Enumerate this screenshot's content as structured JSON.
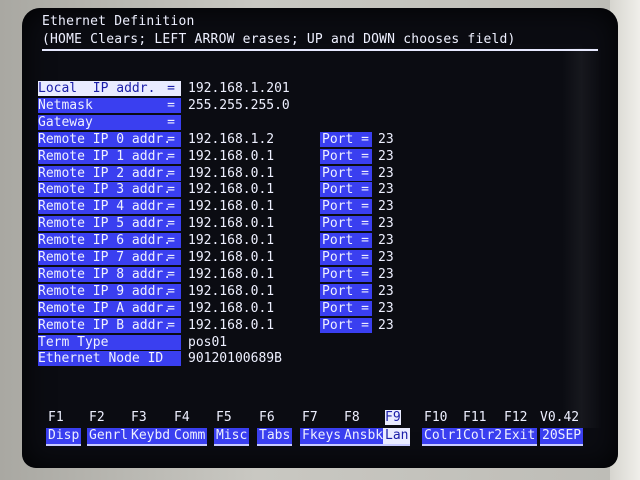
{
  "header": {
    "title": "Ethernet Definition",
    "subtitle": "(HOME Clears; LEFT ARROW erases; UP and DOWN chooses field)"
  },
  "fields": [
    {
      "label": "Local  IP addr.",
      "value": "192.168.1.201"
    },
    {
      "label": "Netmask",
      "value": "255.255.255.0"
    },
    {
      "label": "Gateway",
      "value": ""
    },
    {
      "label": "Remote IP 0 addr.",
      "value": "192.168.1.2",
      "port": "23"
    },
    {
      "label": "Remote IP 1 addr.",
      "value": "192.168.0.1",
      "port": "23"
    },
    {
      "label": "Remote IP 2 addr.",
      "value": "192.168.0.1",
      "port": "23"
    },
    {
      "label": "Remote IP 3 addr.",
      "value": "192.168.0.1",
      "port": "23"
    },
    {
      "label": "Remote IP 4 addr.",
      "value": "192.168.0.1",
      "port": "23"
    },
    {
      "label": "Remote IP 5 addr.",
      "value": "192.168.0.1",
      "port": "23"
    },
    {
      "label": "Remote IP 6 addr.",
      "value": "192.168.0.1",
      "port": "23"
    },
    {
      "label": "Remote IP 7 addr.",
      "value": "192.168.0.1",
      "port": "23"
    },
    {
      "label": "Remote IP 8 addr.",
      "value": "192.168.0.1",
      "port": "23"
    },
    {
      "label": "Remote IP 9 addr.",
      "value": "192.168.0.1",
      "port": "23"
    },
    {
      "label": "Remote IP A addr.",
      "value": "192.168.0.1",
      "port": "23"
    },
    {
      "label": "Remote IP B addr.",
      "value": "192.168.0.1",
      "port": "23"
    },
    {
      "label": "Term Type",
      "value": "pos01"
    },
    {
      "label": "Ethernet Node ID",
      "value": "90120100689B"
    }
  ],
  "equals": "=",
  "port_label": "Port =",
  "function_keys": [
    {
      "key": "F1",
      "label": "Disp"
    },
    {
      "key": "F2",
      "label": "Genrl"
    },
    {
      "key": "F3",
      "label": "Keybd"
    },
    {
      "key": "F4",
      "label": "Comm"
    },
    {
      "key": "F5",
      "label": "Misc"
    },
    {
      "key": "F6",
      "label": "Tabs"
    },
    {
      "key": "F7",
      "label": "Fkeys"
    },
    {
      "key": "F8",
      "label": "Ansbk"
    },
    {
      "key": "F9",
      "label": "Lan",
      "active": true
    },
    {
      "key": "F10",
      "label": "Colr1"
    },
    {
      "key": "F11",
      "label": "Colr2"
    },
    {
      "key": "F12",
      "label": "Exit"
    }
  ],
  "version": {
    "number": "V0.42",
    "date": "20SEP"
  },
  "colors": {
    "highlight": "#3a3ff0",
    "text": "#eef0ff",
    "background": "#0b0c12"
  }
}
